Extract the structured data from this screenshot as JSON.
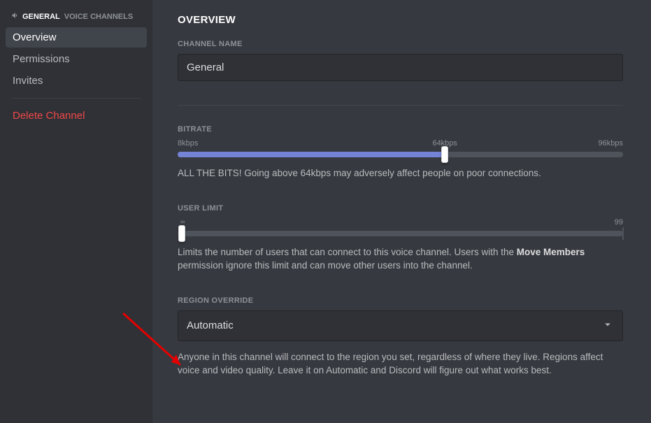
{
  "sidebar": {
    "channel_name": "GENERAL",
    "channel_group": "VOICE CHANNELS",
    "items": [
      {
        "label": "Overview"
      },
      {
        "label": "Permissions"
      },
      {
        "label": "Invites"
      }
    ],
    "delete_label": "Delete Channel"
  },
  "page": {
    "title": "OVERVIEW"
  },
  "channel_name_field": {
    "label": "CHANNEL NAME",
    "value": "General"
  },
  "bitrate": {
    "label": "BITRATE",
    "min_label": "8kbps",
    "mid_label": "64kbps",
    "max_label": "96kbps",
    "percent": 60,
    "help": "ALL THE BITS! Going above 64kbps may adversely affect people on poor connections."
  },
  "user_limit": {
    "label": "USER LIMIT",
    "min_label": "∞",
    "max_label": "99",
    "percent": 0,
    "help_1": "Limits the number of users that can connect to this voice channel. Users with the ",
    "help_bold": "Move Members",
    "help_2": " permission ignore this limit and can move other users into the channel."
  },
  "region": {
    "label": "REGION OVERRIDE",
    "value": "Automatic",
    "help": "Anyone in this channel will connect to the region you set, regardless of where they live. Regions affect voice and video quality. Leave it on Automatic and Discord will figure out what works best."
  }
}
